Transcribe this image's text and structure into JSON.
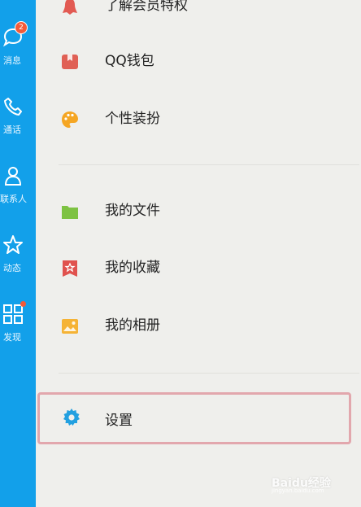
{
  "nav": {
    "items": [
      {
        "label": "消息",
        "badge": "2",
        "icon": "message-icon"
      },
      {
        "label": "通话",
        "icon": "phone-icon"
      },
      {
        "label": "联系人",
        "icon": "contact-icon"
      },
      {
        "label": "动态",
        "icon": "star-icon"
      },
      {
        "label": "发现",
        "icon": "grid-icon",
        "dot": true
      }
    ]
  },
  "menu": {
    "vip": "了解会员特权",
    "wallet": "QQ钱包",
    "dressup": "个性装扮",
    "files": "我的文件",
    "favorites": "我的收藏",
    "album": "我的相册",
    "settings": "设置"
  },
  "watermark": {
    "text": "Baidu经验",
    "sub": "jingyan.baidu.com"
  },
  "colors": {
    "nav_bg": "#12a0ea",
    "badge": "#f25a39",
    "highlight": "#e2a7ad"
  }
}
